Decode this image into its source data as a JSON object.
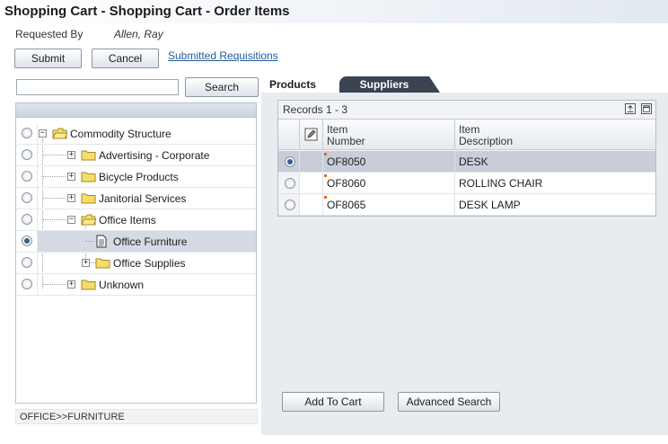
{
  "page": {
    "title": "Shopping Cart - Shopping Cart - Order Items"
  },
  "requested_by": {
    "label": "Requested By",
    "value": "Allen, Ray"
  },
  "actions": {
    "submit": "Submit",
    "cancel": "Cancel",
    "submitted_requisitions": "Submitted Requisitions"
  },
  "search": {
    "value": "",
    "button": "Search"
  },
  "tree": {
    "nodes": [
      {
        "label": "Commodity Structure",
        "selected": false,
        "expander": "−"
      },
      {
        "label": "Advertising - Corporate",
        "selected": false,
        "expander": "+"
      },
      {
        "label": "Bicycle Products",
        "selected": false,
        "expander": "+"
      },
      {
        "label": "Janitorial Services",
        "selected": false,
        "expander": "+"
      },
      {
        "label": "Office Items",
        "selected": false,
        "expander": "−"
      },
      {
        "label": "Office Furniture",
        "selected": true,
        "expander": ""
      },
      {
        "label": "Office Supplies",
        "selected": false,
        "expander": "+"
      },
      {
        "label": "Unknown",
        "selected": false,
        "expander": "+"
      }
    ],
    "path": "OFFICE>>FURNITURE"
  },
  "tabs": {
    "products": "Products",
    "suppliers": "Suppliers"
  },
  "grid": {
    "records": "Records 1 - 3",
    "columns": [
      {
        "line1": "Item",
        "line2": "Number"
      },
      {
        "line1": "Item",
        "line2": "Description"
      }
    ],
    "rows": [
      {
        "number": "OF8050",
        "description": "DESK",
        "selected": true
      },
      {
        "number": "OF8060",
        "description": "ROLLING CHAIR",
        "selected": false
      },
      {
        "number": "OF8065",
        "description": "DESK LAMP",
        "selected": false
      }
    ]
  },
  "bottom_buttons": {
    "add_to_cart": "Add To Cart",
    "advanced_search": "Advanced Search"
  },
  "colors": {
    "selected_row": "#c8ced9",
    "tab_dark": "#3a4452",
    "link": "#1f5d9a"
  }
}
